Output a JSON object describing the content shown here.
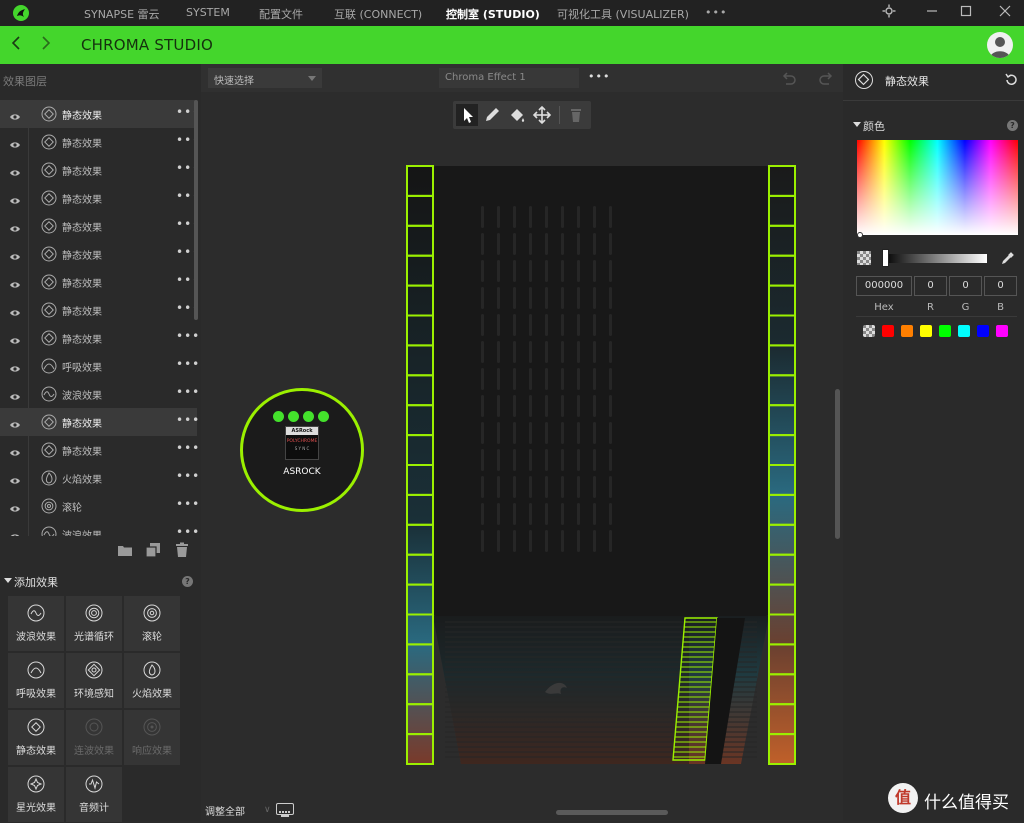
{
  "nav": {
    "tabs": [
      {
        "label": "SYNAPSE 雷云"
      },
      {
        "label": "SYSTEM"
      },
      {
        "label": "配置文件"
      },
      {
        "label": "互联 (CONNECT)"
      },
      {
        "label": "控制室 (STUDIO)"
      },
      {
        "label": "可视化工具 (VISUALIZER)"
      }
    ],
    "more": "•••"
  },
  "header": {
    "title": "CHROMA STUDIO"
  },
  "layers": {
    "title": "效果图层",
    "items": [
      {
        "label": "静态效果",
        "icon": "static-icon"
      },
      {
        "label": "静态效果",
        "icon": "static-icon"
      },
      {
        "label": "静态效果",
        "icon": "static-icon"
      },
      {
        "label": "静态效果",
        "icon": "static-icon"
      },
      {
        "label": "静态效果",
        "icon": "static-icon"
      },
      {
        "label": "静态效果",
        "icon": "static-icon"
      },
      {
        "label": "静态效果",
        "icon": "static-icon"
      },
      {
        "label": "静态效果",
        "icon": "static-icon"
      },
      {
        "label": "静态效果",
        "icon": "static-icon"
      },
      {
        "label": "呼吸效果",
        "icon": "breathing-icon"
      },
      {
        "label": "波浪效果",
        "icon": "wave-icon"
      },
      {
        "label": "静态效果",
        "icon": "static-icon"
      },
      {
        "label": "静态效果",
        "icon": "static-icon"
      },
      {
        "label": "火焰效果",
        "icon": "fire-icon"
      },
      {
        "label": "滚轮",
        "icon": "wheel-icon"
      },
      {
        "label": "波浪效果",
        "icon": "wave-icon"
      }
    ],
    "more": "•••"
  },
  "add_effects": {
    "title": "添加效果",
    "tiles": [
      {
        "label": "波浪效果",
        "icon": "wave-icon",
        "enabled": true
      },
      {
        "label": "光谱循环",
        "icon": "spectrum-cycle-icon",
        "enabled": true
      },
      {
        "label": "滚轮",
        "icon": "wheel-icon",
        "enabled": true
      },
      {
        "label": "呼吸效果",
        "icon": "breathing-icon",
        "enabled": true
      },
      {
        "label": "环境感知",
        "icon": "ambient-icon",
        "enabled": true
      },
      {
        "label": "火焰效果",
        "icon": "fire-icon",
        "enabled": true
      },
      {
        "label": "静态效果",
        "icon": "static-icon",
        "enabled": true
      },
      {
        "label": "连波效果",
        "icon": "ripple-icon",
        "enabled": false
      },
      {
        "label": "响应效果",
        "icon": "reactive-icon",
        "enabled": false
      },
      {
        "label": "星光效果",
        "icon": "starlight-icon",
        "enabled": true
      },
      {
        "label": "音频计",
        "icon": "audio-meter-icon",
        "enabled": true
      }
    ]
  },
  "canvas": {
    "quick_select": "快速选择",
    "effect_name": "Chroma Effect 1",
    "adjust_all": "调整全部",
    "device": {
      "name": "ASROCK",
      "brand": "ASRock",
      "sync": "POLYCHROME",
      "sync_sub": "S Y N C"
    }
  },
  "right_panel": {
    "title": "静态效果",
    "color_section": "颜色",
    "hex_value": "000000",
    "r_value": "0",
    "g_value": "0",
    "b_value": "0",
    "labels": {
      "hex": "Hex",
      "r": "R",
      "g": "G",
      "b": "B"
    },
    "swatches": [
      "#ff0000",
      "#ff7f00",
      "#ffff00",
      "#00ff00",
      "#00ffff",
      "#0000ff",
      "#ff00ff"
    ]
  },
  "watermark": {
    "text": "什么值得买",
    "badge": "值"
  },
  "colors": {
    "accent": "#44d62c",
    "highlight": "#9bf000"
  }
}
